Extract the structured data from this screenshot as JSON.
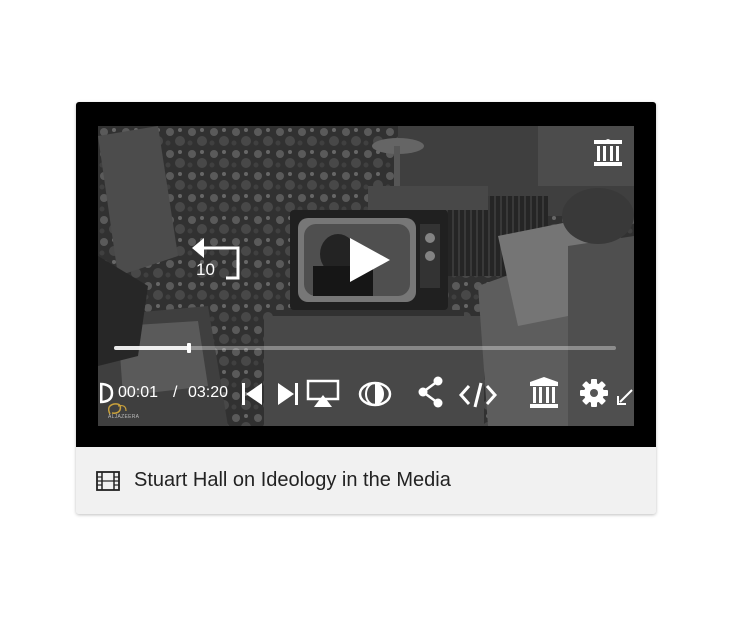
{
  "player": {
    "rewind_seconds": "10",
    "current_time": "00:01",
    "time_separator": "/",
    "duration": "03:20",
    "progress_fraction": 0.15,
    "watermark": "ALJAZEERA"
  },
  "media": {
    "title": "Stuart Hall on Ideology in the Media",
    "type_icon": "film-icon"
  },
  "icons": {
    "rewind": "rewind-10-icon",
    "play": "play-icon",
    "prev": "skip-previous-icon",
    "next": "skip-next-icon",
    "airplay": "airplay-icon",
    "contrast": "contrast-icon",
    "share": "share-icon",
    "embed": "embed-icon",
    "archive": "archive-icon",
    "settings": "gear-icon",
    "fullscreen": "fullscreen-icon",
    "audio_description": "audio-description-icon"
  }
}
